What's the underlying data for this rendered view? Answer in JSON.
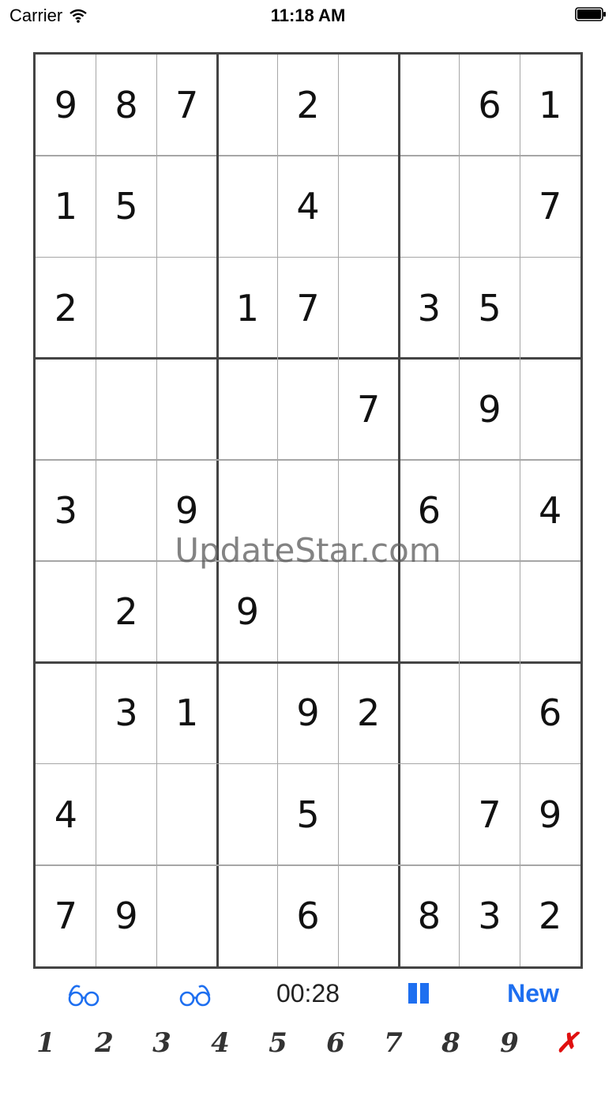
{
  "status_bar": {
    "carrier": "Carrier",
    "time": "11:18 AM"
  },
  "grid": [
    [
      "9",
      "8",
      "7",
      "",
      "2",
      "",
      "",
      "6",
      "1"
    ],
    [
      "1",
      "5",
      "",
      "",
      "4",
      "",
      "",
      "",
      "7"
    ],
    [
      "2",
      "",
      "",
      "1",
      "7",
      "",
      "3",
      "5",
      ""
    ],
    [
      "",
      "",
      "",
      "",
      "",
      "7",
      "",
      "9",
      ""
    ],
    [
      "3",
      "",
      "9",
      "",
      "",
      "",
      "6",
      "",
      "4"
    ],
    [
      "",
      "2",
      "",
      "9",
      "",
      "",
      "",
      "",
      ""
    ],
    [
      "",
      "3",
      "1",
      "",
      "9",
      "2",
      "",
      "",
      "6"
    ],
    [
      "4",
      "",
      "",
      "",
      "5",
      "",
      "",
      "7",
      "9"
    ],
    [
      "7",
      "9",
      "",
      "",
      "6",
      "",
      "8",
      "3",
      "2"
    ]
  ],
  "watermark": "UpdateStar.com",
  "toolbar": {
    "timer": "00:28",
    "new_label": "New",
    "accent_color": "#1e6ff0"
  },
  "numpad": {
    "keys": [
      "1",
      "2",
      "3",
      "4",
      "5",
      "6",
      "7",
      "8",
      "9"
    ],
    "clear_label": "✗",
    "clear_color": "#e01010"
  }
}
